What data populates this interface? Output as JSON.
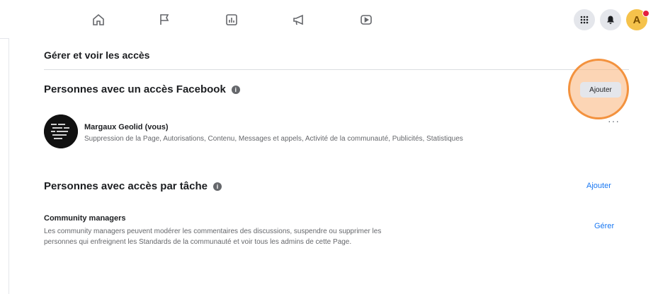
{
  "nav": {
    "icons": [
      "home-icon",
      "flag-icon",
      "insights-icon",
      "megaphone-icon",
      "video-icon"
    ],
    "right": {
      "menu_icon": "grid-menu-icon",
      "bell_icon": "bell-icon",
      "avatar_letter": "A"
    }
  },
  "page": {
    "section_title": "Gérer et voir les accès",
    "facebook_access": {
      "heading": "Personnes avec un accès Facebook",
      "info": "i",
      "add_label": "Ajouter",
      "person": {
        "name": "Margaux Geolid (vous)",
        "permissions": "Suppression de la Page, Autorisations, Contenu, Messages et appels, Activité de la communauté, Publicités, Statistiques",
        "more": "···"
      }
    },
    "task_access": {
      "heading": "Personnes avec accès par tâche",
      "info": "i",
      "add_label": "Ajouter",
      "group": {
        "title": "Community managers",
        "description": "Les community managers peuvent modérer les commentaires des discussions, suspendre ou supprimer les personnes qui enfreignent les Standards de la communauté et voir tous les admins de cette Page.",
        "manage_label": "Gérer"
      }
    }
  },
  "colors": {
    "accent": "#1877f2",
    "highlight": "#f3923e",
    "notification": "#e41e3f"
  }
}
